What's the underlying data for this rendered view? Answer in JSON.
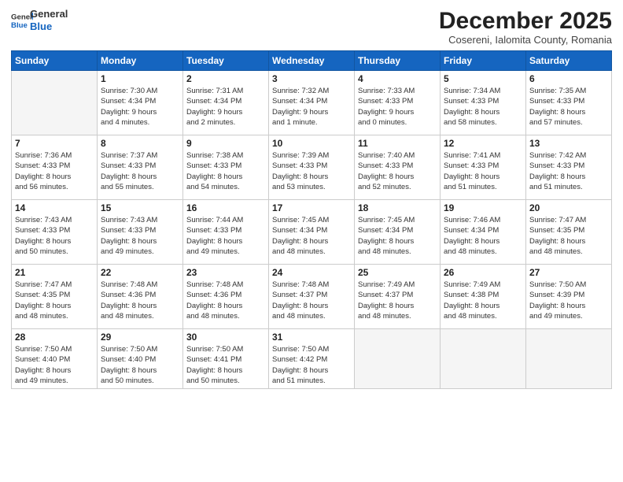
{
  "logo": {
    "general": "General",
    "blue": "Blue"
  },
  "title": "December 2025",
  "location": "Cosereni, Ialomita County, Romania",
  "days_of_week": [
    "Sunday",
    "Monday",
    "Tuesday",
    "Wednesday",
    "Thursday",
    "Friday",
    "Saturday"
  ],
  "weeks": [
    [
      {
        "num": "",
        "info": ""
      },
      {
        "num": "1",
        "info": "Sunrise: 7:30 AM\nSunset: 4:34 PM\nDaylight: 9 hours\nand 4 minutes."
      },
      {
        "num": "2",
        "info": "Sunrise: 7:31 AM\nSunset: 4:34 PM\nDaylight: 9 hours\nand 2 minutes."
      },
      {
        "num": "3",
        "info": "Sunrise: 7:32 AM\nSunset: 4:34 PM\nDaylight: 9 hours\nand 1 minute."
      },
      {
        "num": "4",
        "info": "Sunrise: 7:33 AM\nSunset: 4:33 PM\nDaylight: 9 hours\nand 0 minutes."
      },
      {
        "num": "5",
        "info": "Sunrise: 7:34 AM\nSunset: 4:33 PM\nDaylight: 8 hours\nand 58 minutes."
      },
      {
        "num": "6",
        "info": "Sunrise: 7:35 AM\nSunset: 4:33 PM\nDaylight: 8 hours\nand 57 minutes."
      }
    ],
    [
      {
        "num": "7",
        "info": "Sunrise: 7:36 AM\nSunset: 4:33 PM\nDaylight: 8 hours\nand 56 minutes."
      },
      {
        "num": "8",
        "info": "Sunrise: 7:37 AM\nSunset: 4:33 PM\nDaylight: 8 hours\nand 55 minutes."
      },
      {
        "num": "9",
        "info": "Sunrise: 7:38 AM\nSunset: 4:33 PM\nDaylight: 8 hours\nand 54 minutes."
      },
      {
        "num": "10",
        "info": "Sunrise: 7:39 AM\nSunset: 4:33 PM\nDaylight: 8 hours\nand 53 minutes."
      },
      {
        "num": "11",
        "info": "Sunrise: 7:40 AM\nSunset: 4:33 PM\nDaylight: 8 hours\nand 52 minutes."
      },
      {
        "num": "12",
        "info": "Sunrise: 7:41 AM\nSunset: 4:33 PM\nDaylight: 8 hours\nand 51 minutes."
      },
      {
        "num": "13",
        "info": "Sunrise: 7:42 AM\nSunset: 4:33 PM\nDaylight: 8 hours\nand 51 minutes."
      }
    ],
    [
      {
        "num": "14",
        "info": "Sunrise: 7:43 AM\nSunset: 4:33 PM\nDaylight: 8 hours\nand 50 minutes."
      },
      {
        "num": "15",
        "info": "Sunrise: 7:43 AM\nSunset: 4:33 PM\nDaylight: 8 hours\nand 49 minutes."
      },
      {
        "num": "16",
        "info": "Sunrise: 7:44 AM\nSunset: 4:33 PM\nDaylight: 8 hours\nand 49 minutes."
      },
      {
        "num": "17",
        "info": "Sunrise: 7:45 AM\nSunset: 4:34 PM\nDaylight: 8 hours\nand 48 minutes."
      },
      {
        "num": "18",
        "info": "Sunrise: 7:45 AM\nSunset: 4:34 PM\nDaylight: 8 hours\nand 48 minutes."
      },
      {
        "num": "19",
        "info": "Sunrise: 7:46 AM\nSunset: 4:34 PM\nDaylight: 8 hours\nand 48 minutes."
      },
      {
        "num": "20",
        "info": "Sunrise: 7:47 AM\nSunset: 4:35 PM\nDaylight: 8 hours\nand 48 minutes."
      }
    ],
    [
      {
        "num": "21",
        "info": "Sunrise: 7:47 AM\nSunset: 4:35 PM\nDaylight: 8 hours\nand 48 minutes."
      },
      {
        "num": "22",
        "info": "Sunrise: 7:48 AM\nSunset: 4:36 PM\nDaylight: 8 hours\nand 48 minutes."
      },
      {
        "num": "23",
        "info": "Sunrise: 7:48 AM\nSunset: 4:36 PM\nDaylight: 8 hours\nand 48 minutes."
      },
      {
        "num": "24",
        "info": "Sunrise: 7:48 AM\nSunset: 4:37 PM\nDaylight: 8 hours\nand 48 minutes."
      },
      {
        "num": "25",
        "info": "Sunrise: 7:49 AM\nSunset: 4:37 PM\nDaylight: 8 hours\nand 48 minutes."
      },
      {
        "num": "26",
        "info": "Sunrise: 7:49 AM\nSunset: 4:38 PM\nDaylight: 8 hours\nand 48 minutes."
      },
      {
        "num": "27",
        "info": "Sunrise: 7:50 AM\nSunset: 4:39 PM\nDaylight: 8 hours\nand 49 minutes."
      }
    ],
    [
      {
        "num": "28",
        "info": "Sunrise: 7:50 AM\nSunset: 4:40 PM\nDaylight: 8 hours\nand 49 minutes."
      },
      {
        "num": "29",
        "info": "Sunrise: 7:50 AM\nSunset: 4:40 PM\nDaylight: 8 hours\nand 50 minutes."
      },
      {
        "num": "30",
        "info": "Sunrise: 7:50 AM\nSunset: 4:41 PM\nDaylight: 8 hours\nand 50 minutes."
      },
      {
        "num": "31",
        "info": "Sunrise: 7:50 AM\nSunset: 4:42 PM\nDaylight: 8 hours\nand 51 minutes."
      },
      {
        "num": "",
        "info": ""
      },
      {
        "num": "",
        "info": ""
      },
      {
        "num": "",
        "info": ""
      }
    ]
  ]
}
